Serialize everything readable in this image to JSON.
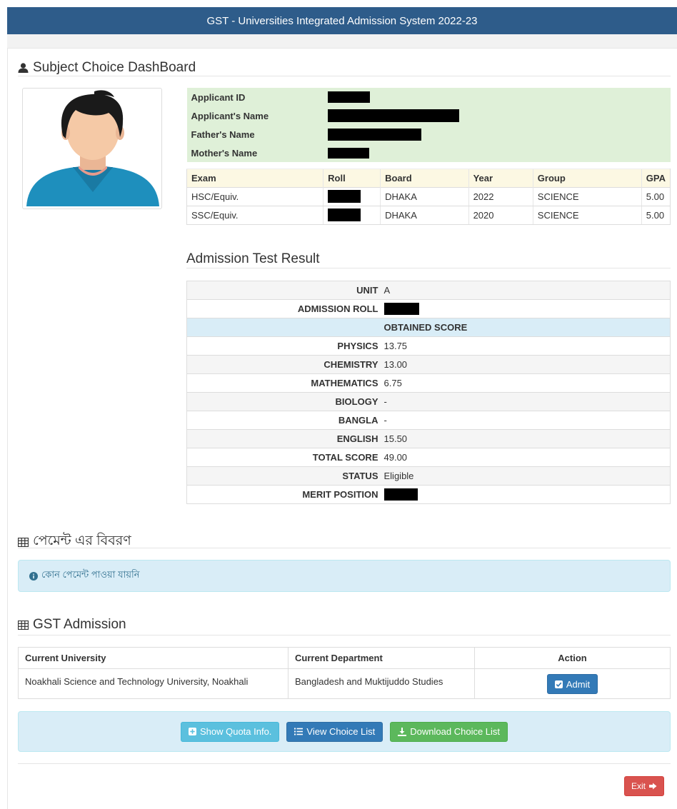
{
  "header": {
    "title": "GST - Universities Integrated Admission System 2022-23"
  },
  "dashboard": {
    "title": "Subject Choice DashBoard",
    "icon": "user-icon"
  },
  "applicant": {
    "labels": {
      "id": "Applicant ID",
      "name": "Applicant's Name",
      "father": "Father's Name",
      "mother": "Mother's Name"
    }
  },
  "exam_table": {
    "headers": [
      "Exam",
      "Roll",
      "Board",
      "Year",
      "Group",
      "GPA"
    ],
    "rows": [
      {
        "exam": "HSC/Equiv.",
        "board": "DHAKA",
        "year": "2022",
        "group": "SCIENCE",
        "gpa": "5.00"
      },
      {
        "exam": "SSC/Equiv.",
        "board": "DHAKA",
        "year": "2020",
        "group": "SCIENCE",
        "gpa": "5.00"
      }
    ]
  },
  "result": {
    "title": "Admission Test Result",
    "unit_label": "UNIT",
    "unit": "A",
    "roll_label": "ADMISSION ROLL",
    "obtained_label": "OBTAINED SCORE",
    "physics_label": "PHYSICS",
    "physics": "13.75",
    "chemistry_label": "CHEMISTRY",
    "chemistry": "13.00",
    "mathematics_label": "MATHEMATICS",
    "mathematics": "6.75",
    "biology_label": "BIOLOGY",
    "biology": "-",
    "bangla_label": "BANGLA",
    "bangla": "-",
    "english_label": "ENGLISH",
    "english": "15.50",
    "total_label": "TOTAL SCORE",
    "total": "49.00",
    "status_label": "STATUS",
    "status": "Eligible",
    "merit_label": "MERIT POSITION"
  },
  "payment": {
    "title": "পেমেন্ট এর বিবরণ",
    "alert": "কোন পেমেন্ট পাওয়া যায়নি"
  },
  "gst_admission": {
    "title": "GST Admission",
    "headers": {
      "university": "Current University",
      "department": "Current Department",
      "action": "Action"
    },
    "university": "Noakhali Science and Technology University, Noakhali",
    "department": "Bangladesh and Muktijuddo Studies",
    "admit_label": "Admit"
  },
  "actions": {
    "quota_label": "Show Quota Info.",
    "view_label": "View Choice List",
    "download_label": "Download Choice List",
    "exit_label": "Exit"
  },
  "colors": {
    "header_bg": "#2e5c8a",
    "primary": "#337ab7",
    "info": "#5bc0de",
    "success": "#5cb85c",
    "danger": "#d9534f",
    "alert_bg": "#d9edf7"
  }
}
